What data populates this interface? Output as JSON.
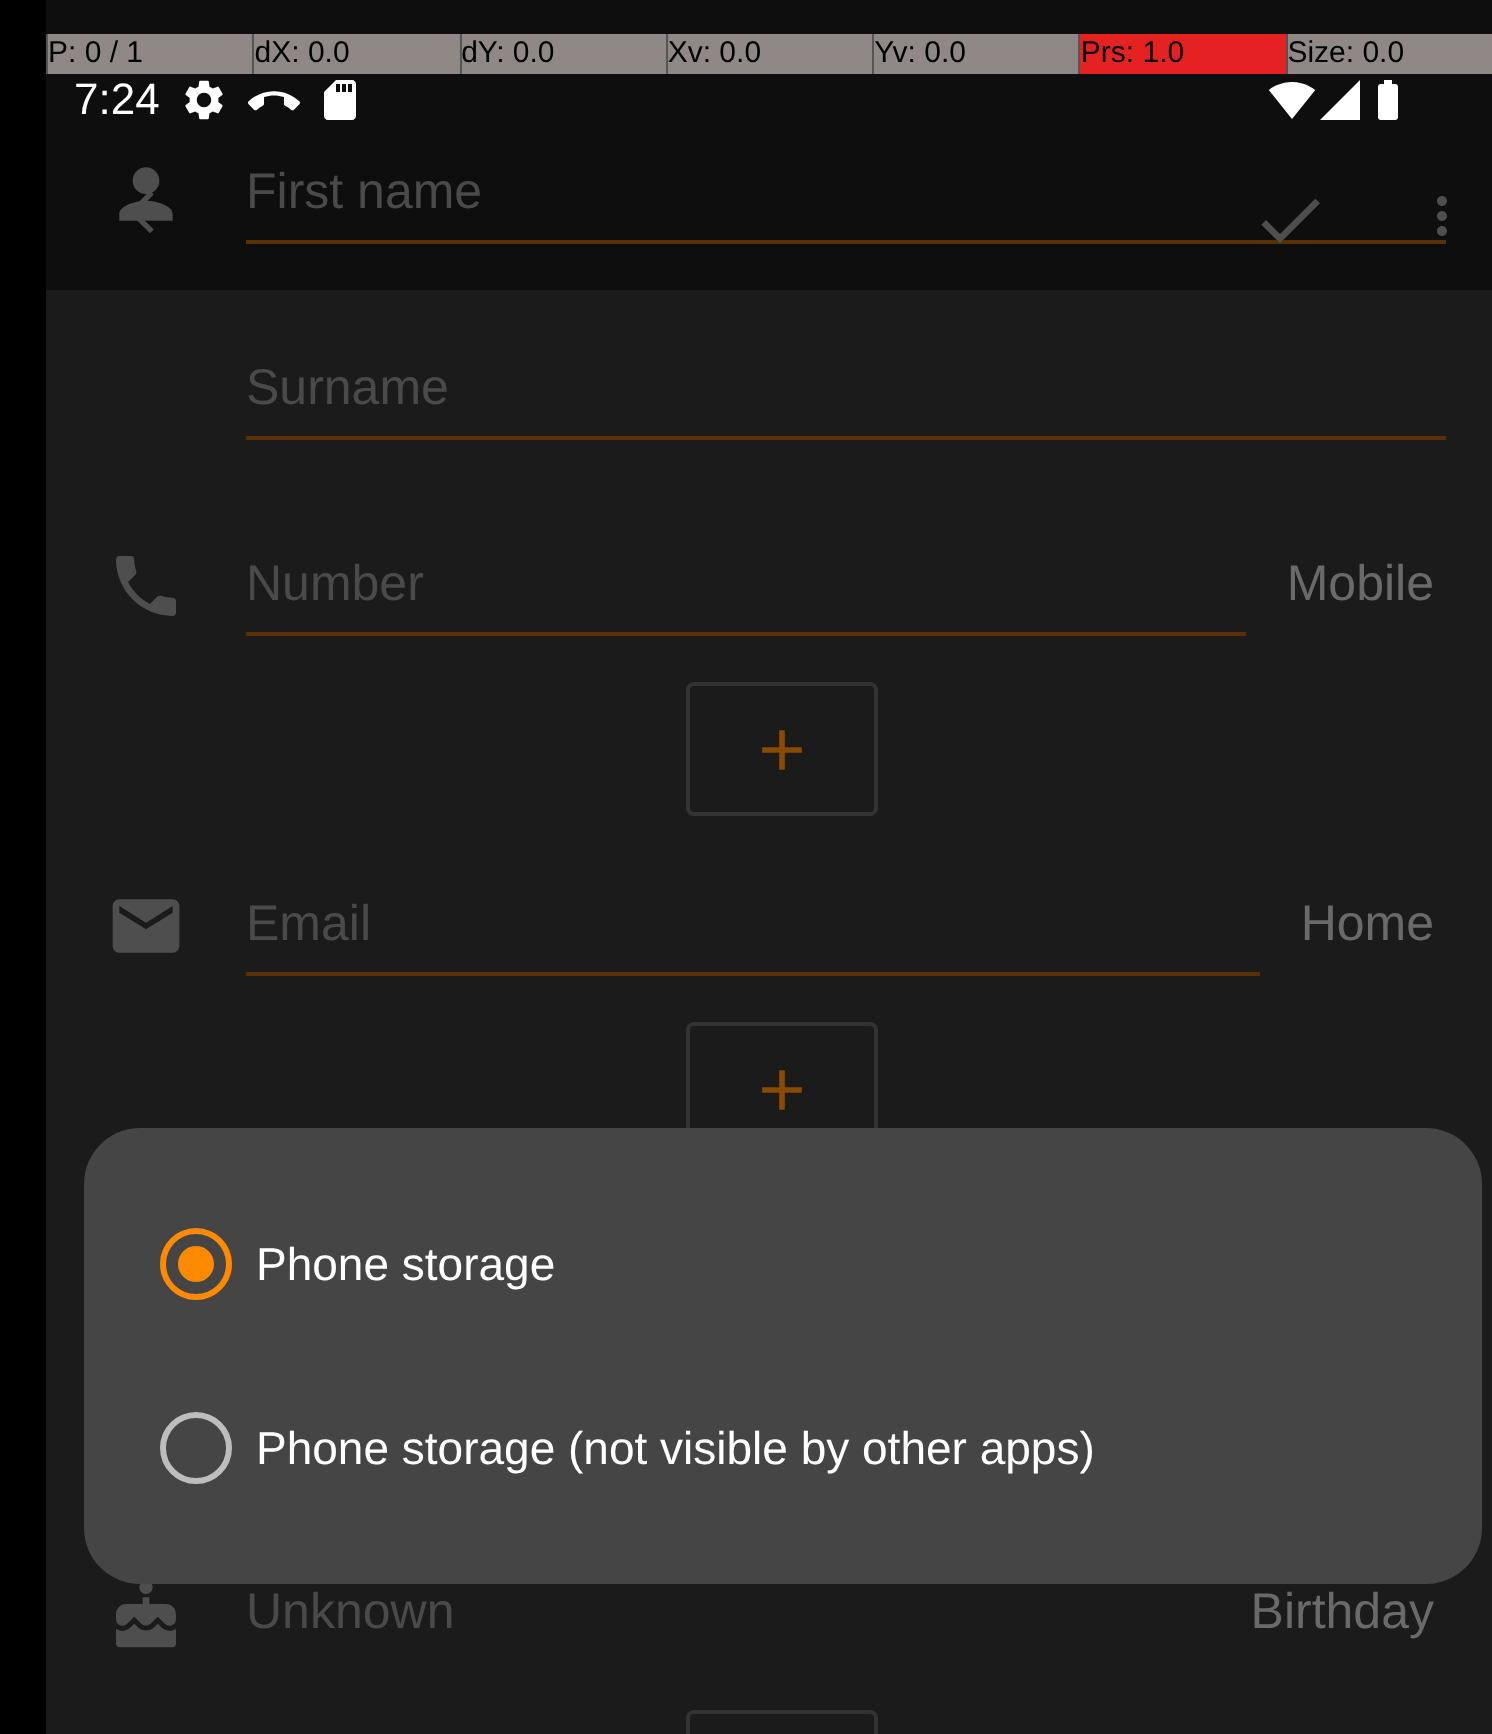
{
  "pointer_overlay": [
    {
      "text": "P: 0 / 1",
      "highlighted": false
    },
    {
      "text": "dX: 0.0",
      "highlighted": false
    },
    {
      "text": "dY: 0.0",
      "highlighted": false
    },
    {
      "text": "Xv: 0.0",
      "highlighted": false
    },
    {
      "text": "Yv: 0.0",
      "highlighted": false
    },
    {
      "text": "Prs: 1.0",
      "highlighted": true
    },
    {
      "text": "Size: 0.0",
      "highlighted": false
    }
  ],
  "status_bar": {
    "time": "7:24"
  },
  "sections": [
    {
      "kind": "name",
      "fields": [
        {
          "placeholder": "First name"
        },
        {
          "placeholder": "Surname"
        }
      ]
    },
    {
      "kind": "phone",
      "fields": [
        {
          "placeholder": "Number"
        }
      ],
      "type_label": "Mobile",
      "add_button": true
    },
    {
      "kind": "email",
      "fields": [
        {
          "placeholder": "Email"
        }
      ],
      "type_label": "Home",
      "add_button": true
    },
    {
      "kind": "birthday",
      "value": "Unknown",
      "type_label": "Birthday",
      "add_button": true
    }
  ],
  "dialog": {
    "options": [
      {
        "label": "Phone storage",
        "selected": true
      },
      {
        "label": "Phone storage (not visible by other apps)",
        "selected": false
      }
    ]
  }
}
